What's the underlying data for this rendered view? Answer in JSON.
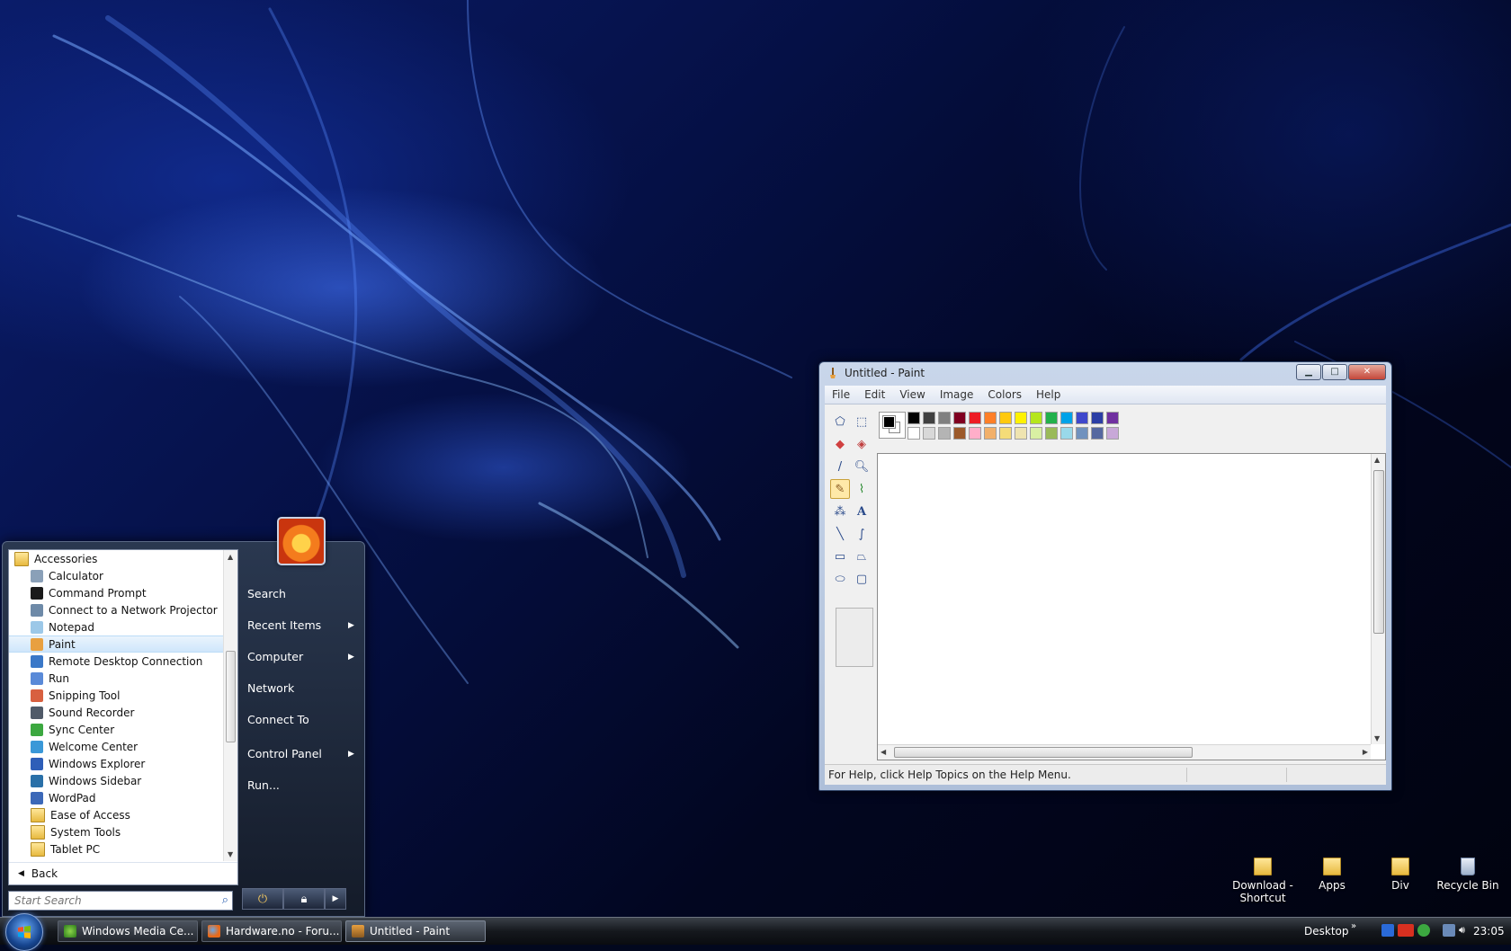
{
  "paint": {
    "title": "Untitled - Paint",
    "menu": [
      "File",
      "Edit",
      "View",
      "Image",
      "Colors",
      "Help"
    ],
    "status": "For Help, click Help Topics on the Help Menu.",
    "palette_top": [
      "#000000",
      "#404040",
      "#808080",
      "#800020",
      "#ed1c24",
      "#ff7f27",
      "#ffc90e",
      "#fff200",
      "#b5e61d",
      "#22b14c",
      "#00a2e8",
      "#3f48cc",
      "#2b3ea5",
      "#7030a0"
    ],
    "palette_bottom": [
      "#ffffff",
      "#d8d8d8",
      "#b4b4b4",
      "#9c5a2b",
      "#ffaec9",
      "#f2b06a",
      "#f5dc78",
      "#efe4b0",
      "#d9f0a3",
      "#9aba59",
      "#99d9ea",
      "#7092be",
      "#5568a0",
      "#c8a8d8"
    ]
  },
  "start_menu": {
    "folder_label": "Accessories",
    "programs": [
      {
        "label": "Calculator",
        "icon": "calculator-icon",
        "color": "#8aa0b8"
      },
      {
        "label": "Command Prompt",
        "icon": "cmd-icon",
        "color": "#1a1a1a"
      },
      {
        "label": "Connect to a Network Projector",
        "icon": "projector-icon",
        "color": "#6e8aa8"
      },
      {
        "label": "Notepad",
        "icon": "notepad-icon",
        "color": "#9cc8e8"
      },
      {
        "label": "Paint",
        "icon": "paint-icon",
        "color": "#e8a040"
      },
      {
        "label": "Remote Desktop Connection",
        "icon": "remote-desktop-icon",
        "color": "#3a78c8"
      },
      {
        "label": "Run",
        "icon": "run-icon",
        "color": "#5a8ad8"
      },
      {
        "label": "Snipping Tool",
        "icon": "scissors-icon",
        "color": "#d86040"
      },
      {
        "label": "Sound Recorder",
        "icon": "microphone-icon",
        "color": "#505a68"
      },
      {
        "label": "Sync Center",
        "icon": "sync-icon",
        "color": "#3ca840"
      },
      {
        "label": "Welcome Center",
        "icon": "welcome-icon",
        "color": "#3a98d8"
      },
      {
        "label": "Windows Explorer",
        "icon": "explorer-icon",
        "color": "#2e5eb8"
      },
      {
        "label": "Windows Sidebar",
        "icon": "sidebar-icon",
        "color": "#2a70a8"
      },
      {
        "label": "WordPad",
        "icon": "wordpad-icon",
        "color": "#3c68b8"
      }
    ],
    "subfolders": [
      "Ease of Access",
      "System Tools",
      "Tablet PC"
    ],
    "back_label": "Back",
    "search_placeholder": "Start Search",
    "right": {
      "search": "Search",
      "recent_items": "Recent Items",
      "computer": "Computer",
      "network": "Network",
      "connect_to": "Connect To",
      "control_panel": "Control Panel",
      "run": "Run..."
    }
  },
  "desktop_icons": [
    {
      "label_line1": "Download -",
      "label_line2": "Shortcut",
      "icon": "folder-icon"
    },
    {
      "label_line1": "Apps",
      "label_line2": "",
      "icon": "folder-icon"
    },
    {
      "label_line1": "Div",
      "label_line2": "",
      "icon": "folder-icon"
    },
    {
      "label_line1": "Recycle Bin",
      "label_line2": "",
      "icon": "recycle-bin-icon"
    }
  ],
  "taskbar": {
    "buttons": [
      {
        "label": "Windows Media Ce...",
        "icon": "media-center-icon"
      },
      {
        "label": "Hardware.no - Foru...",
        "icon": "firefox-icon"
      },
      {
        "label": "Untitled - Paint",
        "icon": "paint-icon"
      }
    ],
    "desktop_toolbar": "Desktop",
    "clock": "23:05"
  }
}
